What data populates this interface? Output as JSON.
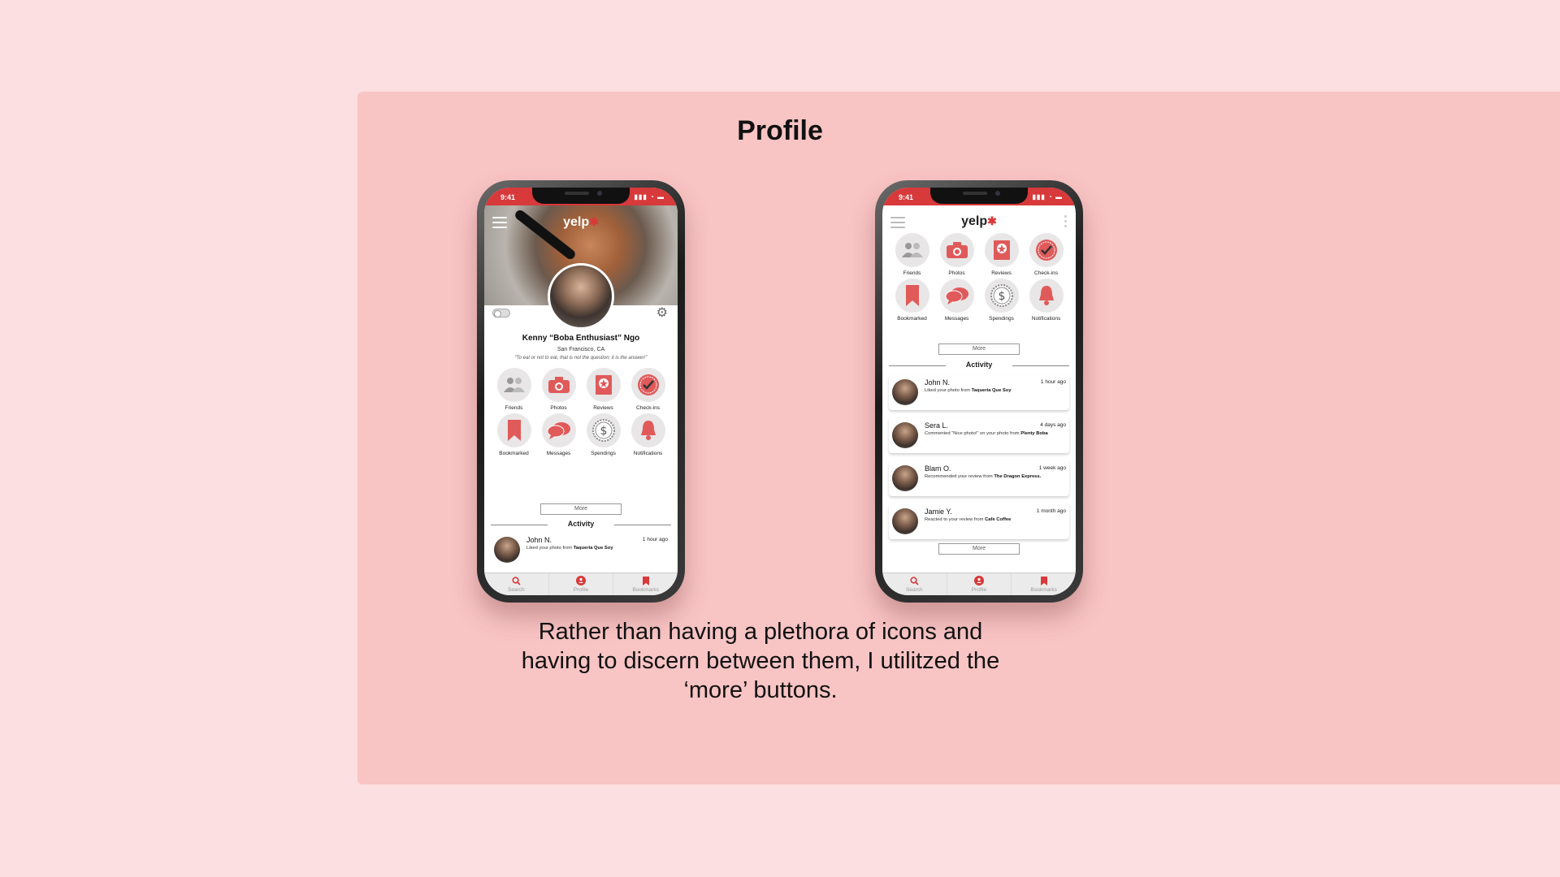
{
  "page": {
    "title": "Profile",
    "caption": "Rather than having a plethora of icons and having to discern between them, I utilitzed the ‘more’ buttons."
  },
  "colors": {
    "accent": "#d8393a",
    "panel": "#f9c4c4",
    "background": "#fcdfe0",
    "icon_bg": "#e8e6e6"
  },
  "status": {
    "time": "9:41"
  },
  "app": {
    "logo": "yelp"
  },
  "profile": {
    "name": "Kenny “Boba Enthusiast” Ngo",
    "location": "San Francisco, CA",
    "quote": "“To eat or not to eat, that is not the question; it is the answer!”"
  },
  "grid": [
    {
      "label": "Friends",
      "icon": "friends-icon"
    },
    {
      "label": "Photos",
      "icon": "camera-icon"
    },
    {
      "label": "Reviews",
      "icon": "reviews-icon"
    },
    {
      "label": "Check-ins",
      "icon": "checkin-icon"
    },
    {
      "label": "Bookmarked",
      "icon": "bookmark-icon"
    },
    {
      "label": "Messages",
      "icon": "messages-icon"
    },
    {
      "label": "Spendings",
      "icon": "dollar-icon"
    },
    {
      "label": "Notifications",
      "icon": "bell-icon"
    }
  ],
  "more_label": "More",
  "activity_title": "Activity",
  "activity": [
    {
      "name": "John N.",
      "time": "1 hour ago",
      "desc": "Liked your photo from ",
      "bold": "Taqueria Que Soy"
    },
    {
      "name": "Sera L.",
      "time": "4 days ago",
      "desc": "Commented “Nice photo!” on your photo from ",
      "bold": "Plenty Boba"
    },
    {
      "name": "Blam O.",
      "time": "1 week ago",
      "desc": "Recommended your review from ",
      "bold": "The Dragon Express."
    },
    {
      "name": "Jamie Y.",
      "time": "1 month ago",
      "desc": "Reacted to your review from ",
      "bold": "Cafe Coffee"
    }
  ],
  "tabs": [
    {
      "label": "Search",
      "icon": "search-icon"
    },
    {
      "label": "Profile",
      "icon": "profile-icon"
    },
    {
      "label": "Bookmarks",
      "icon": "bookmark-icon"
    }
  ]
}
